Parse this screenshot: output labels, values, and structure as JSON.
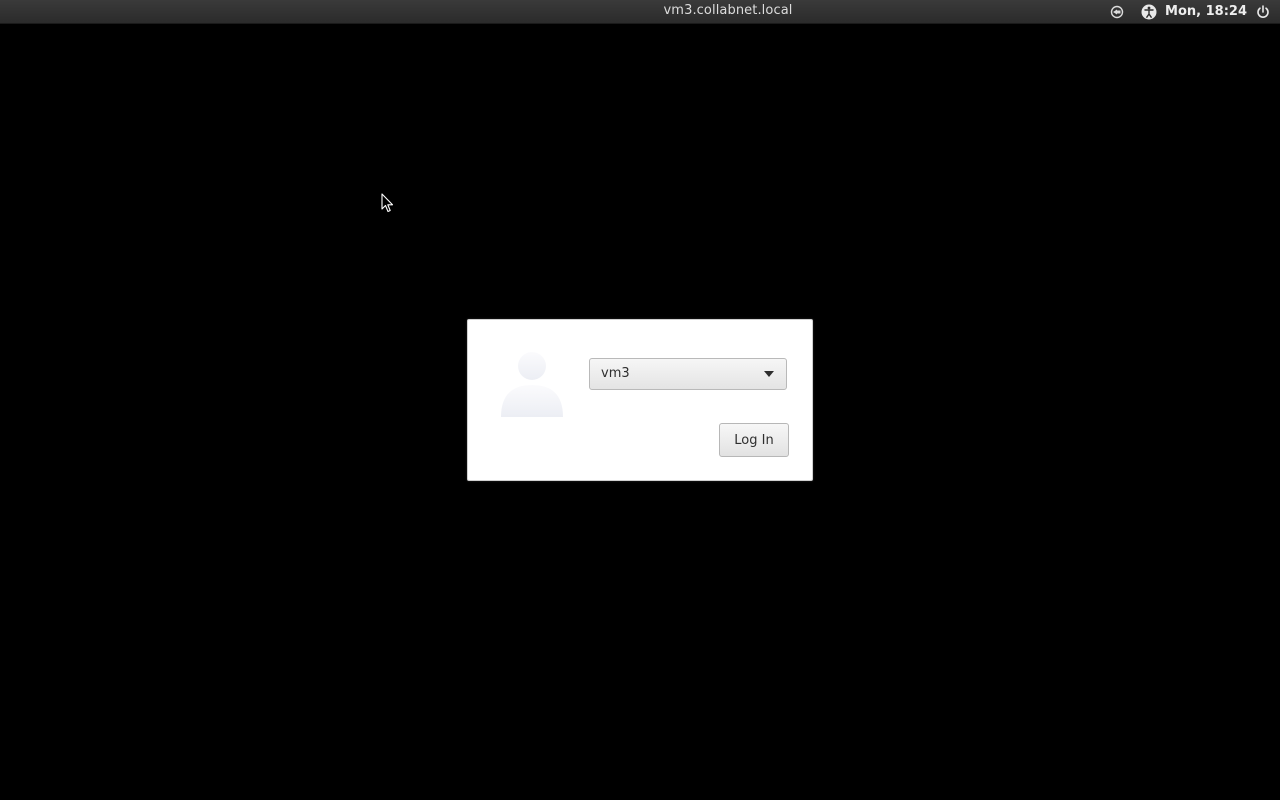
{
  "topbar": {
    "hostname": "vm3.collabnet.local",
    "clock": "Mon, 18:24",
    "icons": [
      "session-icon",
      "accessibility-icon",
      "power-icon"
    ]
  },
  "login": {
    "selected_user": "vm3",
    "login_label": "Log In",
    "avatar_icon": "user-avatar-icon"
  },
  "colors": {
    "background": "#000000",
    "topbar": "#2f2f2f",
    "dialog": "#ffffff"
  }
}
